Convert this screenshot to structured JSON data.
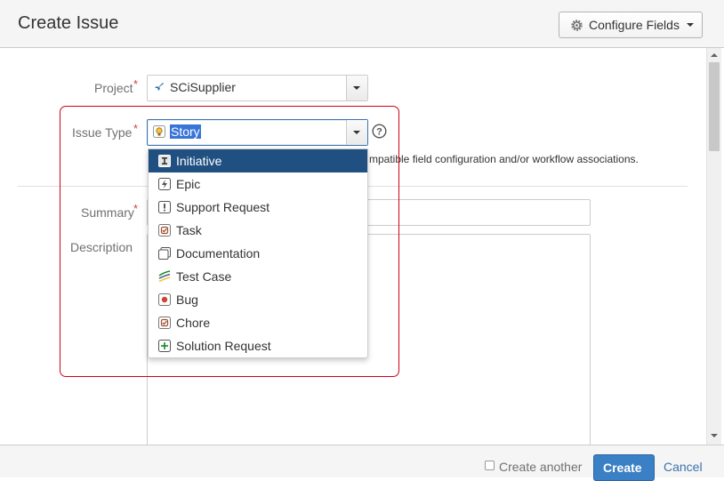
{
  "dialog": {
    "title": "Create Issue",
    "configure_fields_label": "Configure Fields"
  },
  "form": {
    "project_label": "Project",
    "project_value": "SCiSupplier",
    "issue_type_label": "Issue Type",
    "issue_type_value": "Story",
    "issue_type_note": "mpatible field configuration and/or workflow associations.",
    "summary_label": "Summary",
    "description_label": "Description",
    "required_mark": "*"
  },
  "issue_type_options": [
    {
      "label": "Initiative",
      "icon": "initiative-icon",
      "selected": true
    },
    {
      "label": "Epic",
      "icon": "epic-icon",
      "selected": false
    },
    {
      "label": "Support Request",
      "icon": "support-request-icon",
      "selected": false
    },
    {
      "label": "Task",
      "icon": "task-icon",
      "selected": false
    },
    {
      "label": "Documentation",
      "icon": "documentation-icon",
      "selected": false
    },
    {
      "label": "Test Case",
      "icon": "test-case-icon",
      "selected": false
    },
    {
      "label": "Bug",
      "icon": "bug-icon",
      "selected": false
    },
    {
      "label": "Chore",
      "icon": "chore-icon",
      "selected": false
    },
    {
      "label": "Solution Request",
      "icon": "solution-request-icon",
      "selected": false
    }
  ],
  "footer": {
    "create_another_label": "Create another",
    "create_another_checked": false,
    "create_label": "Create",
    "cancel_label": "Cancel"
  },
  "colors": {
    "accent": "#205081",
    "primary_button": "#3b7fc4",
    "link": "#3b73af",
    "required": "#d04437",
    "highlight_outline": "#d0021b"
  }
}
